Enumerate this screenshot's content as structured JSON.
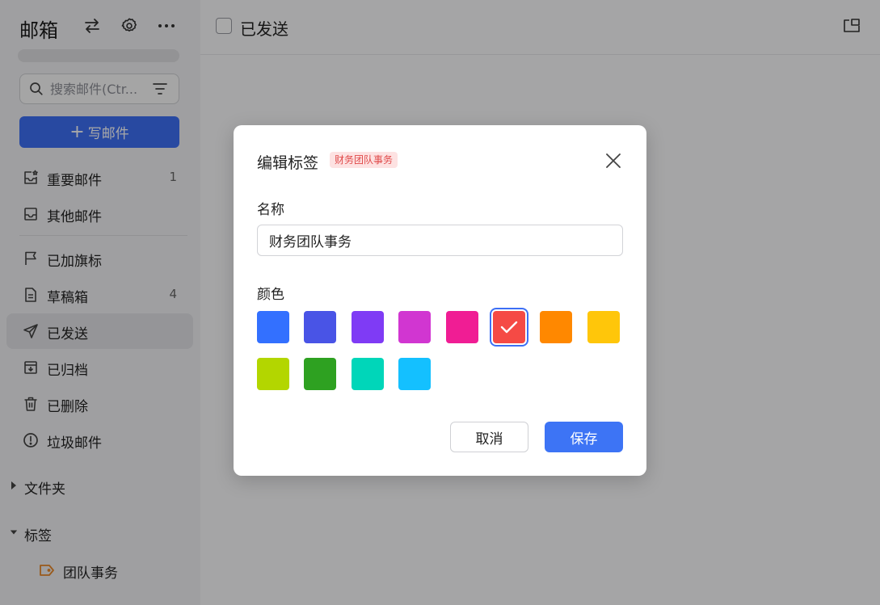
{
  "sidebar": {
    "title": "邮箱",
    "search_placeholder": "搜索邮件(Ctr...",
    "compose": {
      "icon": "+",
      "label": "写邮件"
    },
    "items": [
      {
        "label": "重要邮件",
        "count": "1",
        "icon": "inbox-star-icon"
      },
      {
        "label": "其他邮件",
        "count": "",
        "icon": "inbox-icon"
      },
      {
        "label": "已加旗标",
        "count": "",
        "icon": "flag-icon"
      },
      {
        "label": "草稿箱",
        "count": "4",
        "icon": "draft-icon"
      },
      {
        "label": "已发送",
        "count": "",
        "icon": "send-icon"
      },
      {
        "label": "已归档",
        "count": "",
        "icon": "archive-icon"
      },
      {
        "label": "已删除",
        "count": "",
        "icon": "trash-icon"
      },
      {
        "label": "垃圾邮件",
        "count": "",
        "icon": "spam-icon"
      }
    ],
    "active_item": "已发送",
    "groups": {
      "folders": {
        "label": "文件夹",
        "expanded": false
      },
      "tags": {
        "label": "标签",
        "expanded": true,
        "items": [
          {
            "label": "团队事务",
            "color": "#e8892a"
          }
        ]
      }
    }
  },
  "main": {
    "title": "已发送"
  },
  "modal": {
    "title": "编辑标签",
    "badge": "财务团队事务",
    "name_label": "名称",
    "name_value": "财务团队事务",
    "color_label": "颜色",
    "colors": [
      "#3370ff",
      "#4954e6",
      "#7f3bf5",
      "#d136d1",
      "#f01d94",
      "#f54a45",
      "#ff8800",
      "#ffc60a",
      "#b3d600",
      "#2ea121",
      "#00d6b9",
      "#14c0ff"
    ],
    "selected_color": "#f54a45",
    "cancel_label": "取消",
    "save_label": "保存"
  }
}
